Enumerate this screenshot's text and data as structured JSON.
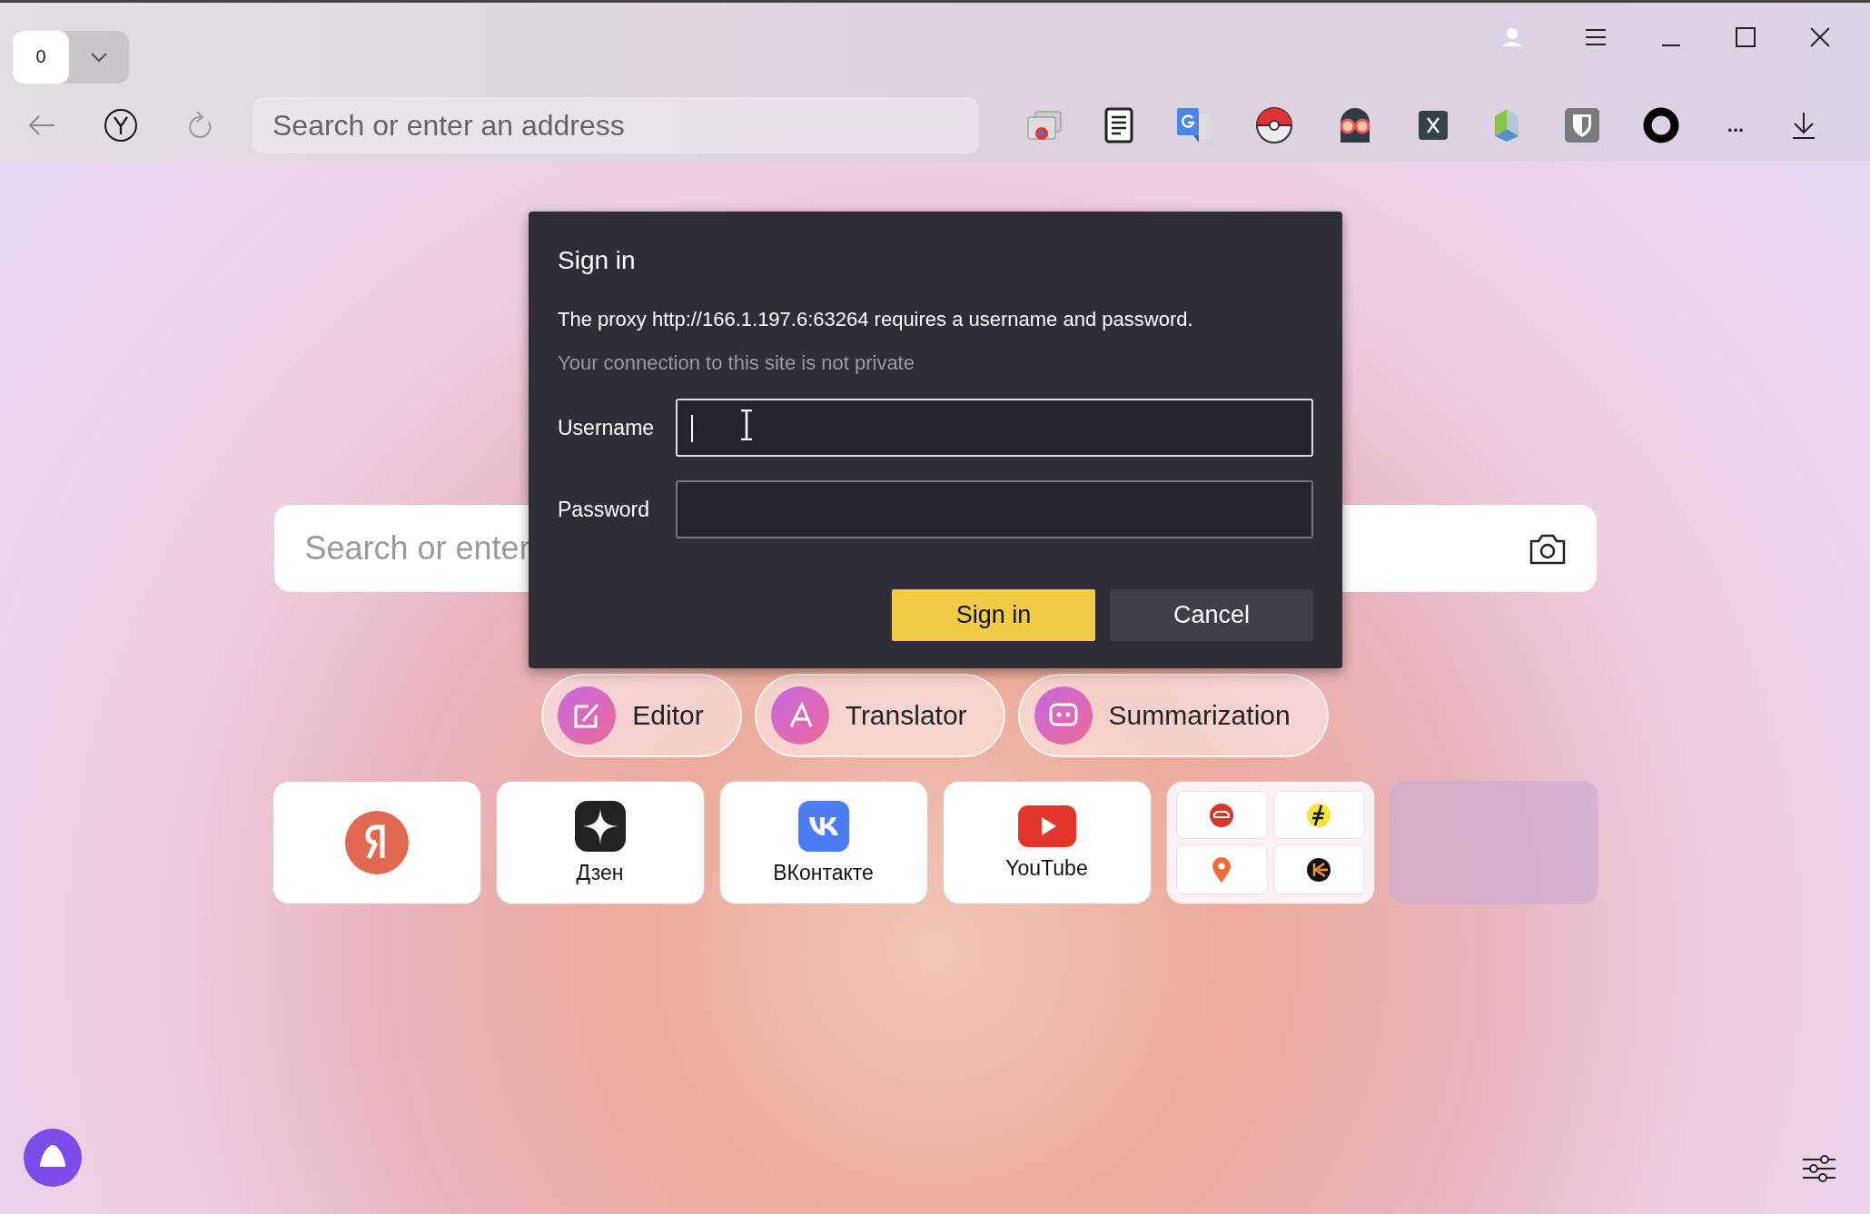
{
  "tab_counter": "0",
  "address_bar": {
    "placeholder": "Search or enter an address"
  },
  "toolbar_more": "...",
  "search": {
    "placeholder": "Search or enter"
  },
  "quick_actions": [
    {
      "kind": "editor",
      "label": "Editor"
    },
    {
      "kind": "translator",
      "label": "Translator"
    },
    {
      "kind": "summary",
      "label": "Summarization"
    }
  ],
  "tiles": [
    {
      "kind": "yandex"
    },
    {
      "kind": "dzen",
      "label": "Дзен"
    },
    {
      "kind": "vk",
      "label": "ВКонтакте"
    },
    {
      "kind": "youtube",
      "label": "YouTube"
    },
    {
      "kind": "group"
    },
    {
      "kind": "empty"
    }
  ],
  "dialog": {
    "title": "Sign in",
    "message": "The proxy http://166.1.197.6:63264 requires a username and password.",
    "note": "Your connection to this site is not private",
    "fields": [
      {
        "label": "Username",
        "focused": true
      },
      {
        "label": "Password",
        "focused": false
      }
    ],
    "buttons": [
      {
        "kind": "primary",
        "label": "Sign in"
      },
      {
        "kind": "secondary",
        "label": "Cancel"
      }
    ]
  }
}
